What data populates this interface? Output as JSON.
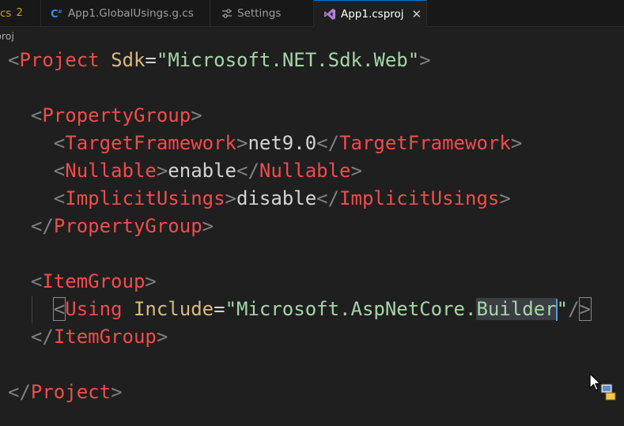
{
  "tabs": {
    "problems_fragment": {
      "label": "cs",
      "count": "2"
    },
    "globalusings": {
      "label": "App1.GlobalUsings.g.cs",
      "icon": "csharp-file-icon"
    },
    "settings": {
      "label": "Settings",
      "icon": "settings-sliders-icon"
    },
    "csproj": {
      "label": "App1.csproj",
      "icon": "visual-studio-icon",
      "close": "✕"
    }
  },
  "breadcrumb": {
    "label": "proj"
  },
  "code": {
    "line1": {
      "lt": "<",
      "tag": "Project",
      "attr": "Sdk",
      "eq": "=",
      "str": "\"Microsoft.NET.Sdk.Web\"",
      "gt": ">"
    },
    "line3": {
      "lt": "<",
      "tag": "PropertyGroup",
      "gt": ">"
    },
    "line4": {
      "lt": "<",
      "tag": "TargetFramework",
      "gt": ">",
      "text": "net9.0",
      "lt2": "</",
      "tag2": "TargetFramework",
      "gt2": ">"
    },
    "line5": {
      "lt": "<",
      "tag": "Nullable",
      "gt": ">",
      "text": "enable",
      "lt2": "</",
      "tag2": "Nullable",
      "gt2": ">"
    },
    "line6": {
      "lt": "<",
      "tag": "ImplicitUsings",
      "gt": ">",
      "text": "disable",
      "lt2": "</",
      "tag2": "ImplicitUsings",
      "gt2": ">"
    },
    "line7": {
      "lt": "</",
      "tag": "PropertyGroup",
      "gt": ">"
    },
    "line9": {
      "lt": "<",
      "tag": "ItemGroup",
      "gt": ">"
    },
    "line10": {
      "lt": "<",
      "tag": "Using",
      "attr": "Include",
      "eq": "=",
      "str_a": "\"Microsoft.AspNetCore.",
      "str_sel": "Builder",
      "str_b": "\"",
      "end": "/",
      "gt": ">"
    },
    "line11": {
      "lt": "</",
      "tag": "ItemGroup",
      "gt": ">"
    },
    "line13": {
      "lt": "</",
      "tag": "Project",
      "gt": ">"
    }
  },
  "colors": {
    "tag": "#f14c4c",
    "attribute": "#d7ba7d",
    "string": "#a5d6a7",
    "bracket": "#808080",
    "background": "#1f1f1f",
    "accent": "#0078d4"
  }
}
